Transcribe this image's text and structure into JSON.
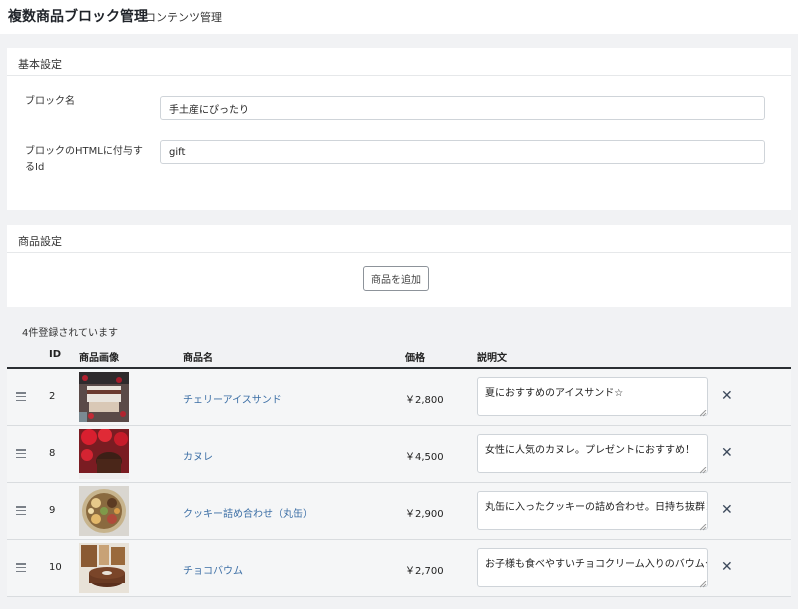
{
  "header": {
    "title": "複数商品ブロック管理",
    "subtitle": "コンテンツ管理"
  },
  "basic_settings": {
    "title": "基本設定",
    "block_name_label": "ブロック名",
    "block_name_value": "手土産にぴったり",
    "html_id_label": "ブロックのHTMLに付与するId",
    "html_id_value": "gift"
  },
  "product_settings": {
    "title": "商品設定",
    "add_button": "商品を追加"
  },
  "list": {
    "count_text": "4件登録されています",
    "columns": {
      "id": "ID",
      "image": "商品画像",
      "name": "商品名",
      "price": "価格",
      "description": "説明文"
    },
    "rows": [
      {
        "id": "2",
        "name": "チェリーアイスサンド",
        "price": "￥2,800",
        "description": "夏におすすめのアイスサンド☆",
        "image_icon": "cherry-ice-sandwich-photo"
      },
      {
        "id": "8",
        "name": "カヌレ",
        "price": "￥4,500",
        "description": "女性に人気のカヌレ。プレゼントにおすすめ！",
        "image_icon": "canele-photo"
      },
      {
        "id": "9",
        "name": "クッキー詰め合わせ（丸缶）",
        "price": "￥2,900",
        "description": "丸缶に入ったクッキーの詰め合わせ。日持ち抜群！",
        "image_icon": "cookie-tin-photo"
      },
      {
        "id": "10",
        "name": "チョコバウム",
        "price": "￥2,700",
        "description": "お子様も食べやすいチョコクリーム入りのバウムクーヘン",
        "image_icon": "choco-baum-photo"
      }
    ]
  },
  "colors": {
    "link": "#3b6ea5",
    "page_bg": "#f1f2f4",
    "row_bg": "#f5f6f7",
    "delete": "#3d4a5c"
  }
}
